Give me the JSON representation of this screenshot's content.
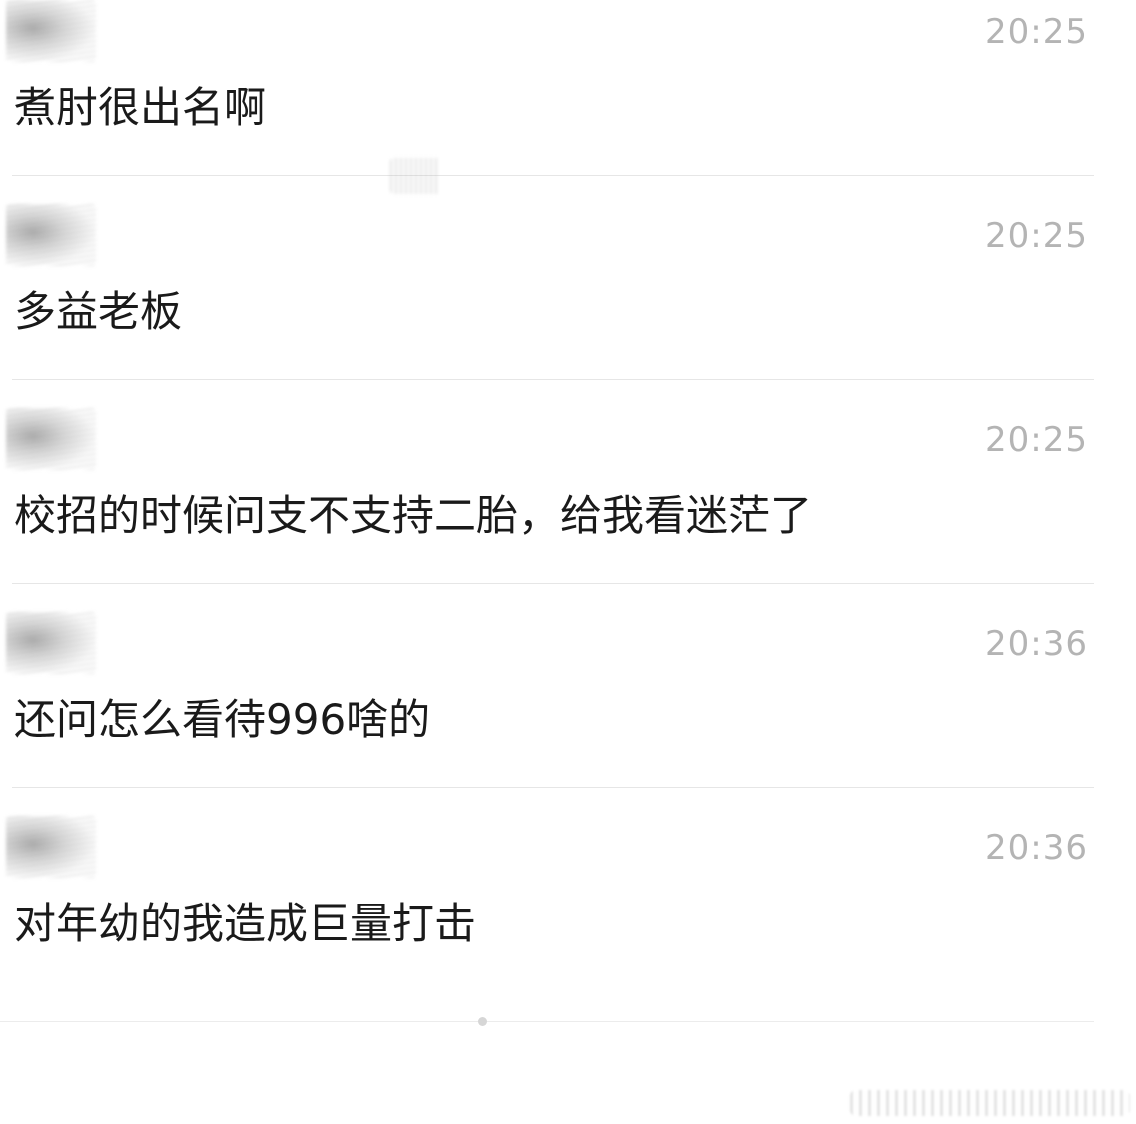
{
  "messages": [
    {
      "time": "20:25",
      "text": "煮肘很出名啊"
    },
    {
      "time": "20:25",
      "text": "多益老板"
    },
    {
      "time": "20:25",
      "text": "校招的时候问支不支持二胎，给我看迷茫了"
    },
    {
      "time": "20:36",
      "text": "还问怎么看待996啥的"
    },
    {
      "time": "20:36",
      "text": "对年幼的我造成巨量打击"
    }
  ]
}
